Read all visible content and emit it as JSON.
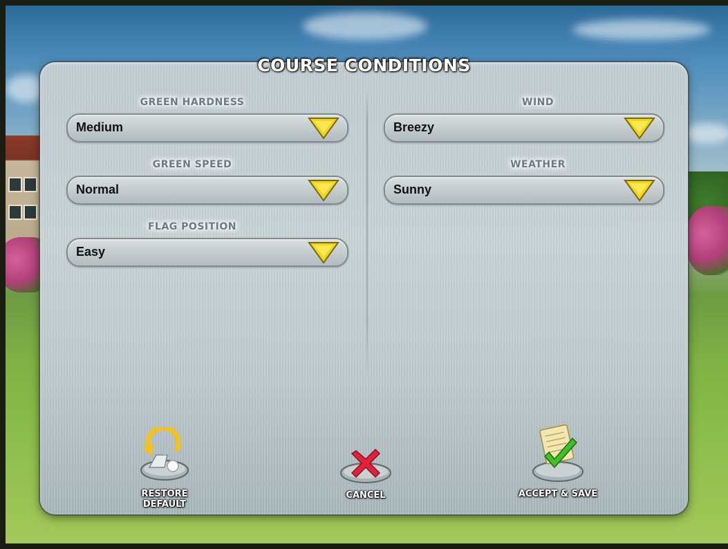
{
  "screen_title": "COURSE CONDITIONS",
  "left_column": {
    "green_hardness": {
      "label": "GREEN HARDNESS",
      "value": "Medium"
    },
    "green_speed": {
      "label": "GREEN SPEED",
      "value": "Normal"
    },
    "flag_position": {
      "label": "FLAG POSITION",
      "value": "Easy"
    }
  },
  "right_column": {
    "wind": {
      "label": "WIND",
      "value": "Breezy"
    },
    "weather": {
      "label": "WEATHER",
      "value": "Sunny"
    }
  },
  "actions": {
    "restore": {
      "label": "RESTORE\nDEFAULT",
      "icon": "restore-club-icon"
    },
    "cancel": {
      "label": "CANCEL",
      "icon": "red-x-icon"
    },
    "accept": {
      "label": "ACCEPT & SAVE",
      "icon": "check-notepad-icon"
    }
  },
  "colors": {
    "arrow_yellow": "#f2d61c",
    "cancel_red": "#e0213a",
    "accept_green": "#3fbf2a",
    "restore_yellow": "#f5c21c"
  }
}
